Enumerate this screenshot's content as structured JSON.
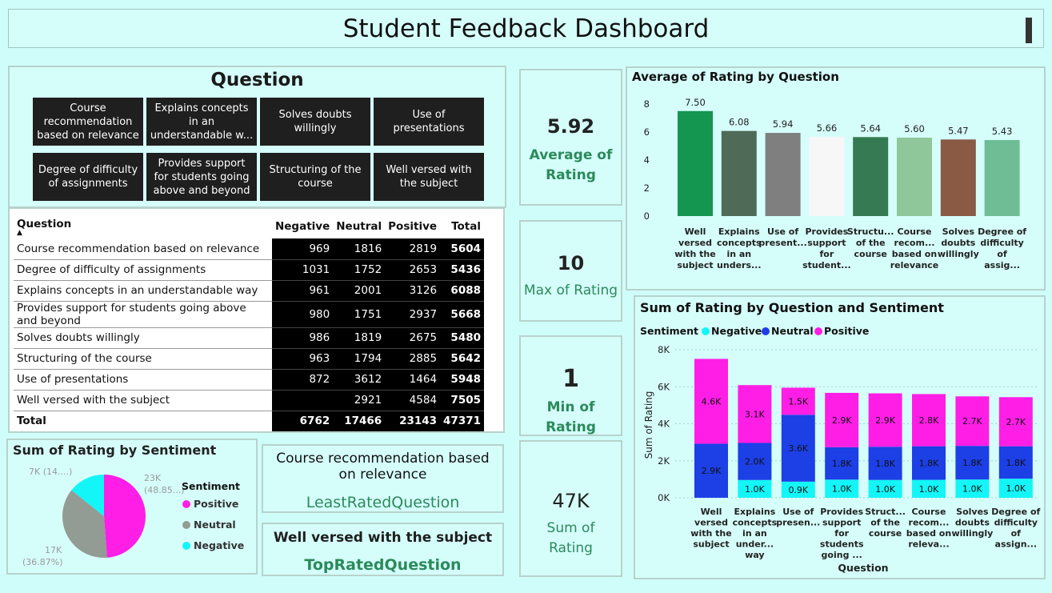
{
  "title": "Student Feedback Dashboard",
  "slicer": {
    "header": "Question",
    "tiles": [
      "Course recommendation based on relevance",
      "Explains concepts in an understandable w...",
      "Solves doubts willingly",
      "Use of presentations",
      "Degree of difficulty of assignments",
      "Provides support for students going above and beyond",
      "Structuring of the course",
      "Well versed with the subject"
    ]
  },
  "matrix": {
    "headers": [
      "Question",
      "Negative",
      "Neutral",
      "Positive",
      "Total"
    ],
    "rows": [
      [
        "Course recommendation based on relevance",
        "969",
        "1816",
        "2819",
        "5604"
      ],
      [
        "Degree of difficulty of assignments",
        "1031",
        "1752",
        "2653",
        "5436"
      ],
      [
        "Explains concepts in an understandable way",
        "961",
        "2001",
        "3126",
        "6088"
      ],
      [
        "Provides support for students going above and beyond",
        "980",
        "1751",
        "2937",
        "5668"
      ],
      [
        "Solves doubts willingly",
        "986",
        "1819",
        "2675",
        "5480"
      ],
      [
        "Structuring of the course",
        "963",
        "1794",
        "2885",
        "5642"
      ],
      [
        "Use of presentations",
        "872",
        "3612",
        "1464",
        "5948"
      ],
      [
        "Well versed with the subject",
        "",
        "2921",
        "4584",
        "7505"
      ]
    ],
    "total": [
      "Total",
      "6762",
      "17466",
      "23143",
      "47371"
    ]
  },
  "kpis": {
    "average": {
      "value": "5.92",
      "label": "Average of Rating"
    },
    "max": {
      "value": "10",
      "label": "Max of Rating"
    },
    "min": {
      "value": "1",
      "label": "Min of Rating"
    },
    "sum": {
      "value": "47K",
      "label": "Sum of Rating"
    }
  },
  "least_card": {
    "value": "Course recommendation based on relevance",
    "label": "LeastRatedQuestion"
  },
  "top_card": {
    "value": "Well versed with the subject",
    "label": "TopRatedQuestion"
  },
  "colors": {
    "positive": "#ff1ee6",
    "neutral": "#1d3fe6",
    "negative": "#14f5f7",
    "pie_neutral": "#939c94",
    "kpi_label": "#2b8a5a"
  },
  "chart_data": [
    {
      "type": "pie",
      "title": "Sum of Rating by Sentiment",
      "legend_title": "Sentiment",
      "legend_position": "right",
      "categories": [
        "Positive",
        "Neutral",
        "Negative"
      ],
      "values": [
        23143,
        17466,
        6762
      ],
      "labels": [
        "23K (48.85...)",
        "17K (36.87%)",
        "7K (14....)"
      ],
      "colors": [
        "#ff1ee6",
        "#939c94",
        "#14f5f7"
      ]
    },
    {
      "type": "bar",
      "title": "Average of Rating by Question",
      "categories": [
        "Well versed with the subject",
        "Explains concepts in an unders...",
        "Use of present...",
        "Provides support for student...",
        "Structu... of the course",
        "Course recom... based on relevance",
        "Solves doubts willingly",
        "Degree of difficulty of assig..."
      ],
      "values": [
        7.5,
        6.08,
        5.94,
        5.66,
        5.64,
        5.6,
        5.47,
        5.43
      ],
      "value_labels": [
        "7.50",
        "6.08",
        "5.94",
        "5.66",
        "5.64",
        "5.60",
        "5.47",
        "5.43"
      ],
      "colors": [
        "#149651",
        "#4f6b57",
        "#7f7f7f",
        "#f7f7f7",
        "#357a52",
        "#8fc69a",
        "#8a5a44",
        "#6fbd95"
      ],
      "yticks": [
        "0",
        "2",
        "4",
        "6",
        "8"
      ],
      "ylim": [
        0,
        8
      ],
      "grid": false
    },
    {
      "type": "bar",
      "stacked": true,
      "title": "Sum of Rating by Question and Sentiment",
      "legend_title": "Sentiment",
      "legend_position": "top-left",
      "xlabel": "Question",
      "ylabel": "Sum of Rating",
      "categories": [
        "Well versed with the subject",
        "Explains concepts in an under... way",
        "Use of presen...",
        "Provides support for students going ...",
        "Struct... of the course",
        "Course recom... based on releva...",
        "Solves doubts willingly",
        "Degree of difficulty of assign..."
      ],
      "series": [
        {
          "name": "Negative",
          "values": [
            0,
            961,
            872,
            980,
            963,
            969,
            986,
            1031
          ],
          "labels": [
            "",
            "1.0K",
            "0.9K",
            "1.0K",
            "1.0K",
            "1.0K",
            "1.0K",
            "1.0K"
          ]
        },
        {
          "name": "Neutral",
          "values": [
            2921,
            2001,
            3612,
            1751,
            1794,
            1816,
            1819,
            1752
          ],
          "labels": [
            "2.9K",
            "2.0K",
            "3.6K",
            "1.8K",
            "1.8K",
            "1.8K",
            "1.8K",
            "1.8K"
          ]
        },
        {
          "name": "Positive",
          "values": [
            4584,
            3126,
            1464,
            2937,
            2885,
            2819,
            2675,
            2653
          ],
          "labels": [
            "4.6K",
            "3.1K",
            "1.5K",
            "2.9K",
            "2.9K",
            "2.8K",
            "2.7K",
            "2.7K"
          ]
        }
      ],
      "yticks": [
        "0K",
        "2K",
        "4K",
        "6K",
        "8K"
      ],
      "ylim": [
        0,
        8000
      ],
      "grid": true
    }
  ]
}
